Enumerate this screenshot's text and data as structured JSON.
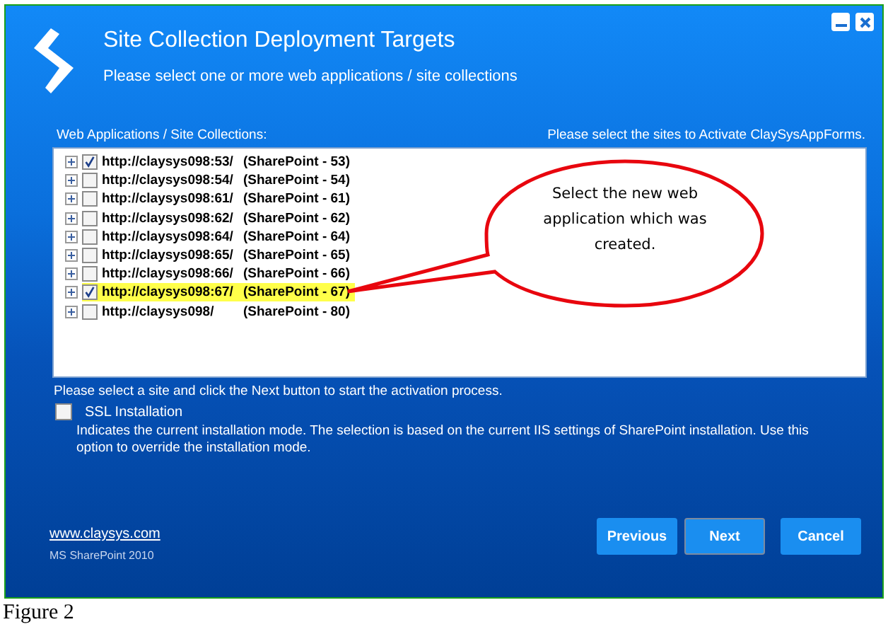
{
  "window": {
    "title": "Site Collection Deployment Targets",
    "subtitle": "Please select one or more web applications / site collections"
  },
  "list_label": "Web Applications / Site Collections:",
  "list_hint": "Please select the sites to Activate ClaySysAppForms.",
  "sites": [
    {
      "url": "http://claysys098:53/",
      "name": "(SharePoint - 53)",
      "checked": true,
      "highlighted": false
    },
    {
      "url": "http://claysys098:54/",
      "name": "(SharePoint - 54)",
      "checked": false,
      "highlighted": false
    },
    {
      "url": "http://claysys098:61/",
      "name": "(SharePoint - 61)",
      "checked": false,
      "highlighted": false
    },
    {
      "url": "http://claysys098:62/",
      "name": "(SharePoint - 62)",
      "checked": false,
      "highlighted": false
    },
    {
      "url": "http://claysys098:64/",
      "name": "(SharePoint - 64)",
      "checked": false,
      "highlighted": false
    },
    {
      "url": "http://claysys098:65/",
      "name": "(SharePoint - 65)",
      "checked": false,
      "highlighted": false
    },
    {
      "url": "http://claysys098:66/",
      "name": "(SharePoint - 66)",
      "checked": false,
      "highlighted": false
    },
    {
      "url": "http://claysys098:67/",
      "name": "(SharePoint - 67)",
      "checked": true,
      "highlighted": true
    },
    {
      "url": "http://claysys098/",
      "name": "(SharePoint - 80)",
      "checked": false,
      "highlighted": false
    }
  ],
  "callout": {
    "text": "Select the new web application which was created."
  },
  "instruction": "Please select a site and click the Next button to start the activation process.",
  "ssl": {
    "label": "SSL Installation",
    "checked": false,
    "description": "Indicates the current installation mode. The selection is based on the current IIS settings of SharePoint installation. Use this option to override the installation mode."
  },
  "footer": {
    "link": "www.claysys.com",
    "product": "MS SharePoint 2010"
  },
  "buttons": [
    "Previous",
    "Next",
    "Cancel"
  ],
  "caption": "Figure 2"
}
